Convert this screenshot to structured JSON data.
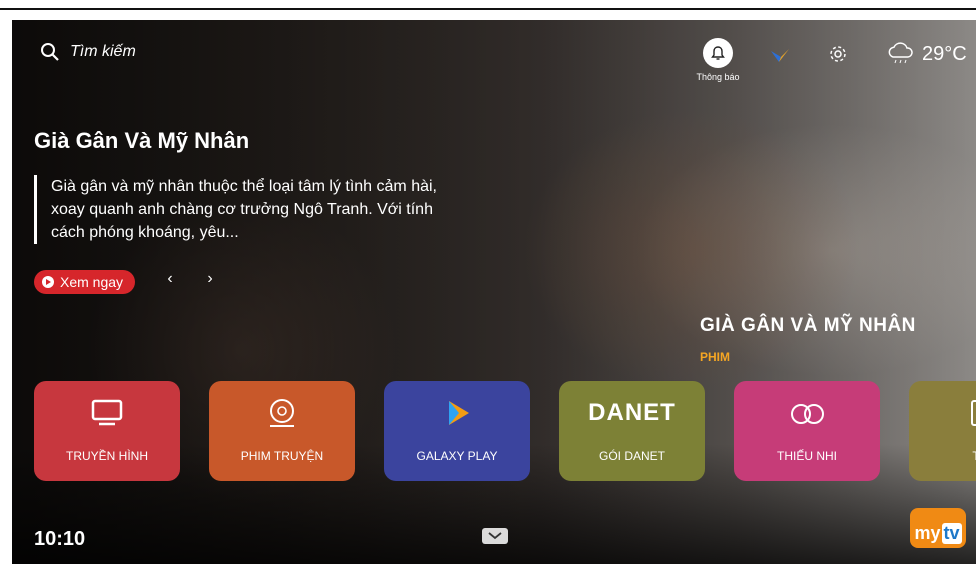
{
  "search": {
    "placeholder": "Tìm kiếm"
  },
  "header": {
    "notification_label": "Thông báo",
    "temperature": "29°C"
  },
  "hero": {
    "title": "Già Gân Và Mỹ Nhân",
    "description": "Già gân và mỹ nhân thuộc thể loại tâm lý tình cảm hài, xoay quanh anh chàng cơ trưởng Ngô Tranh. Với tính cách phóng khoáng, yêu...",
    "watch_label": "Xem ngay",
    "prev": "‹",
    "next": "›",
    "poster_title": "GIÀ GÂN VÀ MỸ NHÂN",
    "poster_sub": "PHIM"
  },
  "tiles": [
    {
      "label": "TRUYỀN HÌNH",
      "color": "#c7373e",
      "icon": "tv-icon"
    },
    {
      "label": "PHIM TRUYỆN",
      "color": "#c8582a",
      "icon": "film-reel-icon"
    },
    {
      "label": "GALAXY PLAY",
      "color": "#3b449e",
      "icon": "galaxy-play-logo"
    },
    {
      "label": "GÓI DANET",
      "color": "#7d8136",
      "icon": "danet-logo",
      "logo_text": "DANET"
    },
    {
      "label": "THIẾU NHI",
      "color": "#c63c78",
      "icon": "kids-icon"
    },
    {
      "label": "TIN",
      "color": "#8a7e3c",
      "icon": "news-icon"
    }
  ],
  "footer": {
    "clock": "10:10",
    "brand": "my",
    "brand_tv": "tv"
  }
}
